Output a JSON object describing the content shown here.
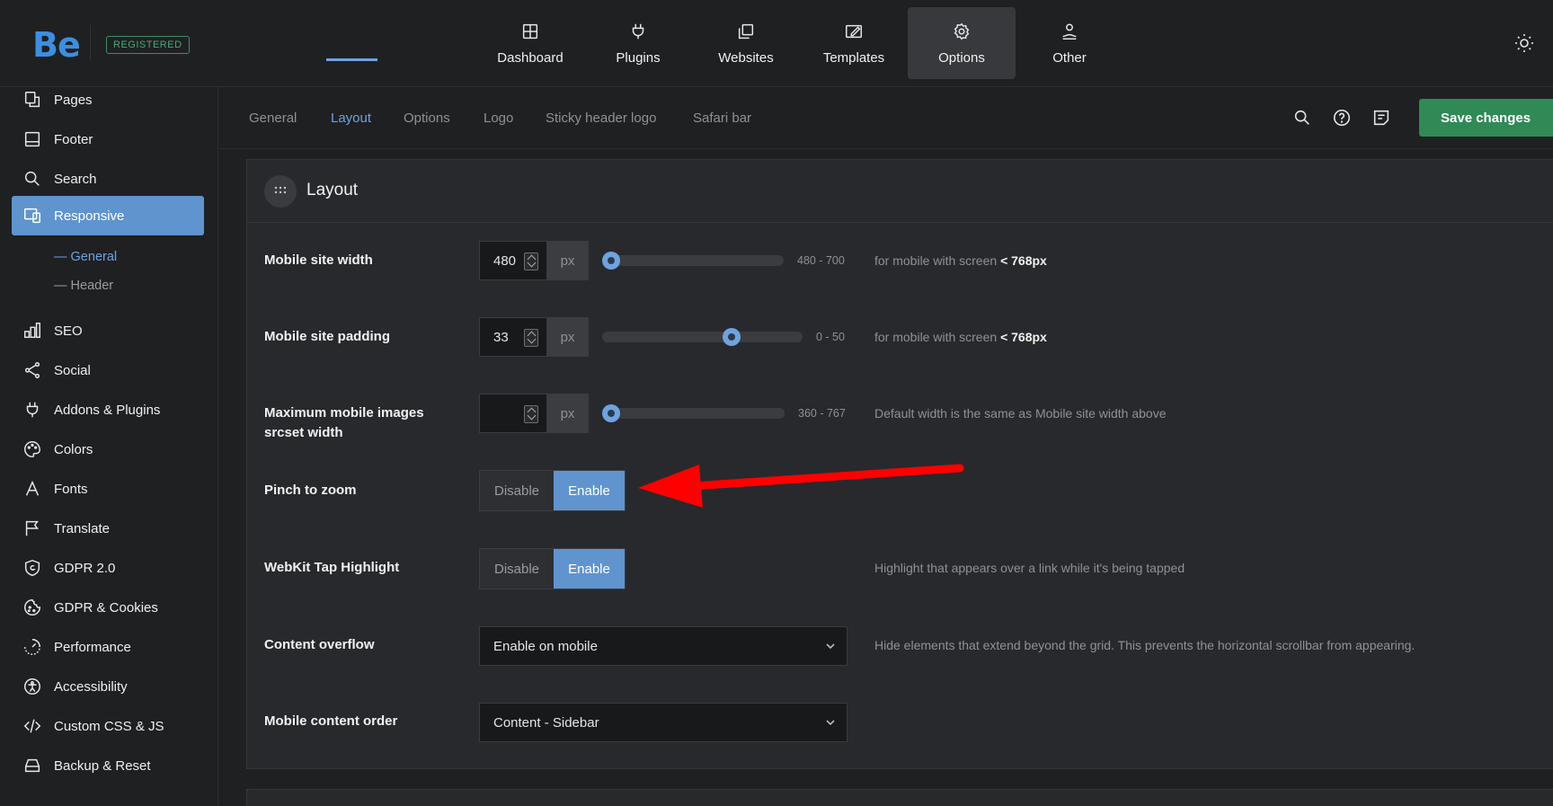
{
  "header": {
    "logo": "Be",
    "badge": "REGISTERED",
    "nav": [
      {
        "label": "Dashboard",
        "icon": "dashboard-icon"
      },
      {
        "label": "Plugins",
        "icon": "plug-icon"
      },
      {
        "label": "Websites",
        "icon": "websites-icon"
      },
      {
        "label": "Templates",
        "icon": "templates-icon"
      },
      {
        "label": "Options",
        "icon": "gear-icon",
        "active": true
      },
      {
        "label": "Other",
        "icon": "user-hand-icon"
      }
    ]
  },
  "sidebar": {
    "items": [
      {
        "label": "Pages",
        "icon": "pages-icon"
      },
      {
        "label": "Footer",
        "icon": "footer-icon"
      },
      {
        "label": "Search",
        "icon": "search-icon"
      },
      {
        "label": "Responsive",
        "icon": "responsive-icon",
        "active": true
      },
      {
        "label": "SEO",
        "icon": "seo-chart-icon"
      },
      {
        "label": "Social",
        "icon": "share-icon"
      },
      {
        "label": "Addons & Plugins",
        "icon": "plug-icon"
      },
      {
        "label": "Colors",
        "icon": "palette-icon"
      },
      {
        "label": "Fonts",
        "icon": "font-icon"
      },
      {
        "label": "Translate",
        "icon": "flag-icon"
      },
      {
        "label": "GDPR 2.0",
        "icon": "shield-icon"
      },
      {
        "label": "GDPR & Cookies",
        "icon": "cookie-icon"
      },
      {
        "label": "Performance",
        "icon": "performance-icon"
      },
      {
        "label": "Accessibility",
        "icon": "accessibility-icon"
      },
      {
        "label": "Custom CSS & JS",
        "icon": "code-icon"
      },
      {
        "label": "Backup & Reset",
        "icon": "backup-icon"
      }
    ],
    "subitems": [
      {
        "label": "General",
        "active": true
      },
      {
        "label": "Header"
      }
    ]
  },
  "subtabs": [
    "General",
    "Layout",
    "Options",
    "Logo",
    "Sticky header logo",
    "Safari bar"
  ],
  "active_subtab": "Layout",
  "toolbar": {
    "save_label": "Save changes"
  },
  "panel": {
    "title": "Layout",
    "fields": {
      "mobile_width": {
        "label": "Mobile site width",
        "value": "480",
        "unit": "px",
        "range": "480 - 700",
        "slider_fraction": 0.0,
        "hint": "for mobile with screen ",
        "hint_bold": "< 768px"
      },
      "mobile_padding": {
        "label": "Mobile site padding",
        "value": "33",
        "unit": "px",
        "range": "0 - 50",
        "slider_fraction": 0.66,
        "hint": "for mobile with screen ",
        "hint_bold": "< 768px"
      },
      "srcset_width": {
        "label": "Maximum mobile images srcset width",
        "value": "",
        "unit": "px",
        "range": "360 - 767",
        "slider_fraction": 0.0,
        "hint": "Default width is the same as Mobile site width above"
      },
      "pinch_zoom": {
        "label": "Pinch to zoom",
        "off": "Disable",
        "on": "Enable",
        "selected": "Enable"
      },
      "tap_highlight": {
        "label": "WebKit Tap Highlight",
        "off": "Disable",
        "on": "Enable",
        "selected": "Enable",
        "hint": "Highlight that appears over a link while it's being tapped"
      },
      "content_overflow": {
        "label": "Content overflow",
        "value": "Enable on mobile",
        "hint": "Hide elements that extend beyond the grid. This prevents the horizontal scrollbar from appearing."
      },
      "content_order": {
        "label": "Mobile content order",
        "value": "Content - Sidebar"
      }
    }
  },
  "colors": {
    "accent": "#5f94cf",
    "save": "#2f8a56",
    "annotation_arrow": "#ff0000"
  }
}
